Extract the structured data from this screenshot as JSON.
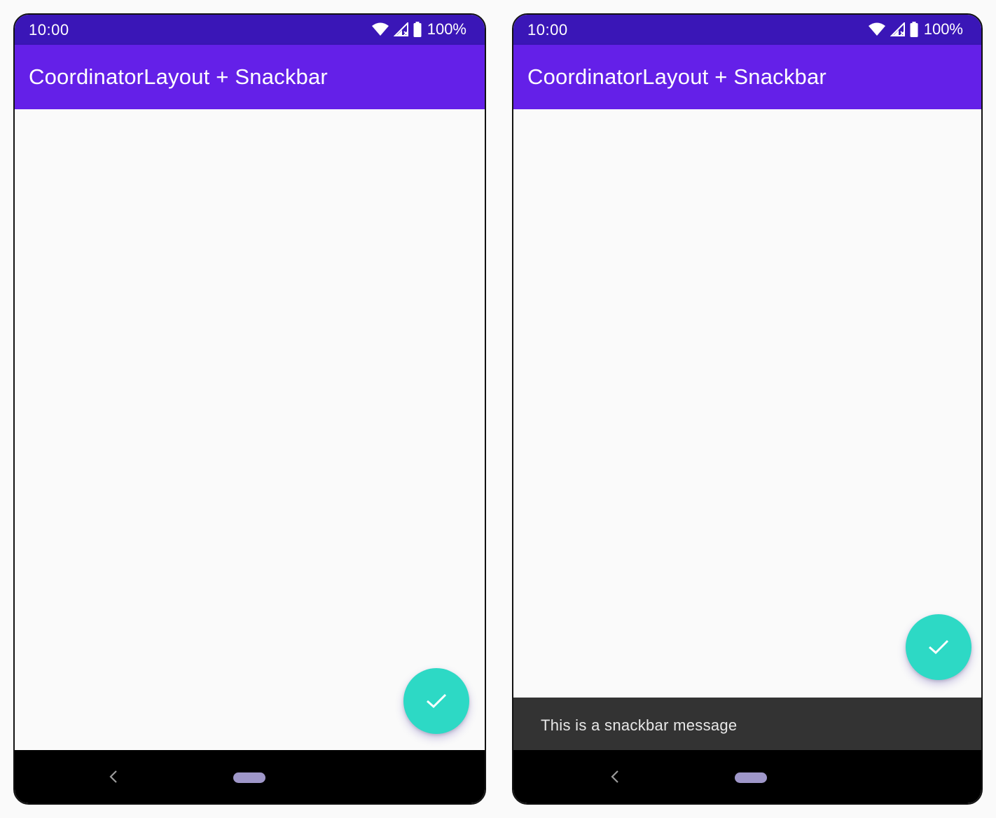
{
  "colors": {
    "status_bar": "#3a16b7",
    "app_bar": "#6420e8",
    "fab": "#2dd9c5",
    "snackbar": "#333333",
    "nav_bar": "#000000",
    "home_pill": "#9f97c9"
  },
  "phones": [
    {
      "status": {
        "time": "10:00",
        "battery": "100%",
        "icons": [
          "wifi-icon",
          "signal-icon",
          "battery-icon"
        ]
      },
      "app_bar": {
        "title": "CoordinatorLayout + Snackbar"
      },
      "fab": {
        "icon": "check-icon"
      },
      "nav": {
        "back_icon": "back-chevron-icon",
        "home_icon": "home-pill-icon"
      }
    },
    {
      "status": {
        "time": "10:00",
        "battery": "100%",
        "icons": [
          "wifi-icon",
          "signal-icon",
          "battery-icon"
        ]
      },
      "app_bar": {
        "title": "CoordinatorLayout + Snackbar"
      },
      "fab": {
        "icon": "check-icon"
      },
      "snackbar": {
        "message": "This is a snackbar message"
      },
      "nav": {
        "back_icon": "back-chevron-icon",
        "home_icon": "home-pill-icon"
      }
    }
  ]
}
